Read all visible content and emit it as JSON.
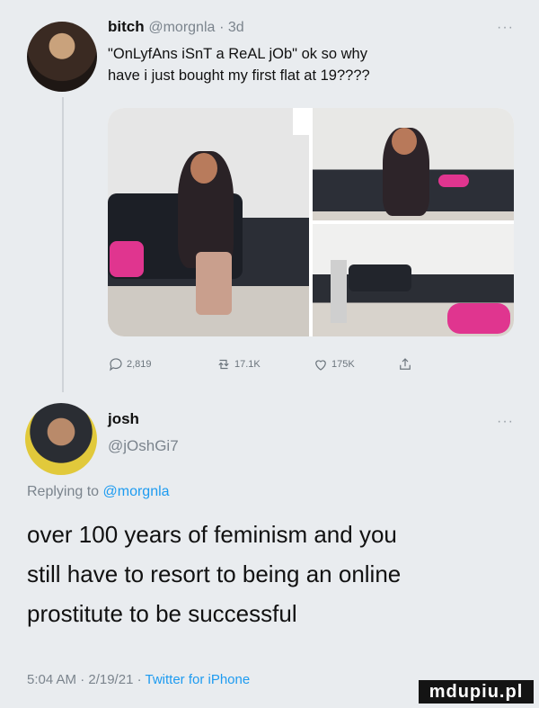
{
  "tweet": {
    "author_name": "bitch",
    "author_handle": "@morgnla",
    "age": "· 3d",
    "more": "···",
    "text_line1": "\"OnLyfAns iSnT a ReAL jOb\" ok so why",
    "text_line2": "have i just bought my first flat at 19????",
    "actions": {
      "replies": "2,819",
      "retweets": "17.1K",
      "likes": "175K"
    }
  },
  "reply": {
    "author_name": "josh",
    "author_handle": "@jOshGi7",
    "more": "···",
    "replying_prefix": "Replying to",
    "replying_to": "@morgnla",
    "text_line1": "over 100 years of feminism and you",
    "text_line2": "still have to resort to being an online",
    "text_line3": "prostitute to be successful",
    "time": "5:04 AM · 2/19/21 ·",
    "source": "Twitter for iPhone"
  },
  "watermark": "mdupiu.pl",
  "colors": {
    "link": "#1d9bf0",
    "muted": "#7b848d",
    "background": "#e9ecef"
  }
}
